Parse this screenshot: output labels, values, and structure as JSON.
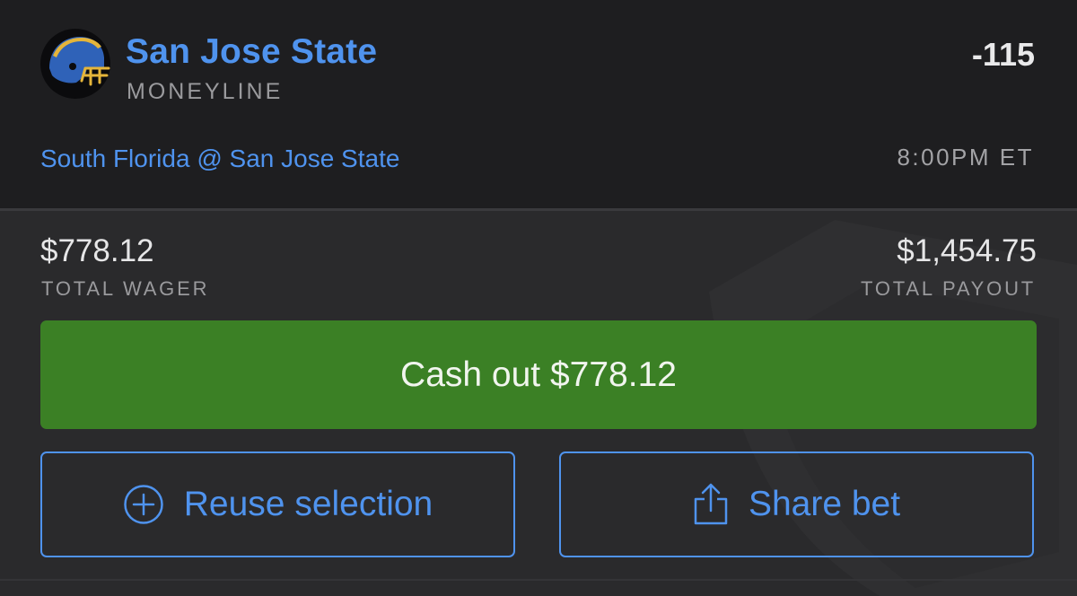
{
  "bet": {
    "team_name": "San Jose State",
    "market": "MONEYLINE",
    "odds": "-115",
    "matchup": "South Florida @ San Jose State",
    "start_time": "8:00PM ET"
  },
  "summary": {
    "wager_amount": "$778.12",
    "wager_label": "TOTAL WAGER",
    "payout_amount": "$1,454.75",
    "payout_label": "TOTAL PAYOUT"
  },
  "actions": {
    "cash_out_label": "Cash out $778.12",
    "reuse_label": "Reuse selection",
    "share_label": "Share bet"
  },
  "colors": {
    "accent_blue": "#4f93ee",
    "cash_out_green": "#3b8025",
    "background": "#1e1e20",
    "panel": "#2a2a2c"
  },
  "icons": {
    "team_logo": "football-helmet-icon",
    "reuse": "plus-circle-icon",
    "share": "share-icon",
    "watermark": "shield-icon"
  }
}
